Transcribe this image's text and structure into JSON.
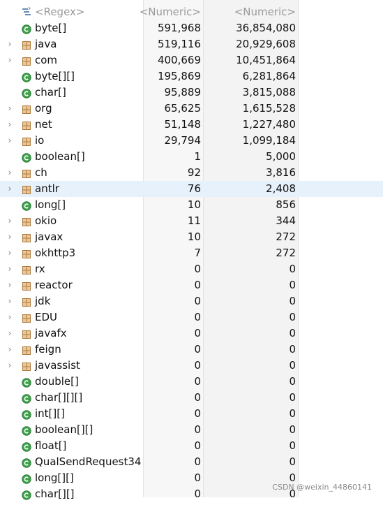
{
  "header": {
    "name_filter": "<Regex>",
    "col1_filter": "<Numeric>",
    "col2_filter": "<Numeric>"
  },
  "rows": [
    {
      "type": "class",
      "expandable": false,
      "name": "byte[]",
      "objects": "591,968",
      "shallow": "36,854,080"
    },
    {
      "type": "package",
      "expandable": true,
      "name": "java",
      "objects": "519,116",
      "shallow": "20,929,608"
    },
    {
      "type": "package",
      "expandable": true,
      "name": "com",
      "objects": "400,669",
      "shallow": "10,451,864"
    },
    {
      "type": "class",
      "expandable": false,
      "name": "byte[][]",
      "objects": "195,869",
      "shallow": "6,281,864"
    },
    {
      "type": "class",
      "expandable": false,
      "name": "char[]",
      "objects": "95,889",
      "shallow": "3,815,088"
    },
    {
      "type": "package",
      "expandable": true,
      "name": "org",
      "objects": "65,625",
      "shallow": "1,615,528"
    },
    {
      "type": "package",
      "expandable": true,
      "name": "net",
      "objects": "51,148",
      "shallow": "1,227,480"
    },
    {
      "type": "package",
      "expandable": true,
      "name": "io",
      "objects": "29,794",
      "shallow": "1,099,184"
    },
    {
      "type": "class",
      "expandable": false,
      "name": "boolean[]",
      "objects": "1",
      "shallow": "5,000"
    },
    {
      "type": "package",
      "expandable": true,
      "name": "ch",
      "objects": "92",
      "shallow": "3,816"
    },
    {
      "type": "package",
      "expandable": true,
      "name": "antlr",
      "objects": "76",
      "shallow": "2,408",
      "selected": true
    },
    {
      "type": "class",
      "expandable": false,
      "name": "long[]",
      "objects": "10",
      "shallow": "856"
    },
    {
      "type": "package",
      "expandable": true,
      "name": "okio",
      "objects": "11",
      "shallow": "344"
    },
    {
      "type": "package",
      "expandable": true,
      "name": "javax",
      "objects": "10",
      "shallow": "272"
    },
    {
      "type": "package",
      "expandable": true,
      "name": "okhttp3",
      "objects": "7",
      "shallow": "272"
    },
    {
      "type": "package",
      "expandable": true,
      "name": "rx",
      "objects": "0",
      "shallow": "0"
    },
    {
      "type": "package",
      "expandable": true,
      "name": "reactor",
      "objects": "0",
      "shallow": "0"
    },
    {
      "type": "package",
      "expandable": true,
      "name": "jdk",
      "objects": "0",
      "shallow": "0"
    },
    {
      "type": "package",
      "expandable": true,
      "name": "EDU",
      "objects": "0",
      "shallow": "0"
    },
    {
      "type": "package",
      "expandable": true,
      "name": "javafx",
      "objects": "0",
      "shallow": "0"
    },
    {
      "type": "package",
      "expandable": true,
      "name": "feign",
      "objects": "0",
      "shallow": "0"
    },
    {
      "type": "package",
      "expandable": true,
      "name": "javassist",
      "objects": "0",
      "shallow": "0"
    },
    {
      "type": "class",
      "expandable": false,
      "name": "double[]",
      "objects": "0",
      "shallow": "0"
    },
    {
      "type": "class",
      "expandable": false,
      "name": "char[][][]",
      "objects": "0",
      "shallow": "0"
    },
    {
      "type": "class",
      "expandable": false,
      "name": "int[][]",
      "objects": "0",
      "shallow": "0"
    },
    {
      "type": "class",
      "expandable": false,
      "name": "boolean[][]",
      "objects": "0",
      "shallow": "0"
    },
    {
      "type": "class",
      "expandable": false,
      "name": "float[]",
      "objects": "0",
      "shallow": "0"
    },
    {
      "type": "class",
      "expandable": false,
      "name": "QualSendRequest34",
      "objects": "0",
      "shallow": "0"
    },
    {
      "type": "class",
      "expandable": false,
      "name": "long[][]",
      "objects": "0",
      "shallow": "0"
    },
    {
      "type": "class",
      "expandable": false,
      "name": "char[][]",
      "objects": "0",
      "shallow": "0"
    }
  ],
  "expander_glyph": "›",
  "icons": {
    "class": "class-icon",
    "package": "package-icon",
    "filter": "filter-icon"
  },
  "colors": {
    "selected_row": "#e6f1fb",
    "class_icon": "#3fa34d",
    "package_icon": "#b07a3a"
  },
  "watermark": "CSDN @weixin_44860141"
}
